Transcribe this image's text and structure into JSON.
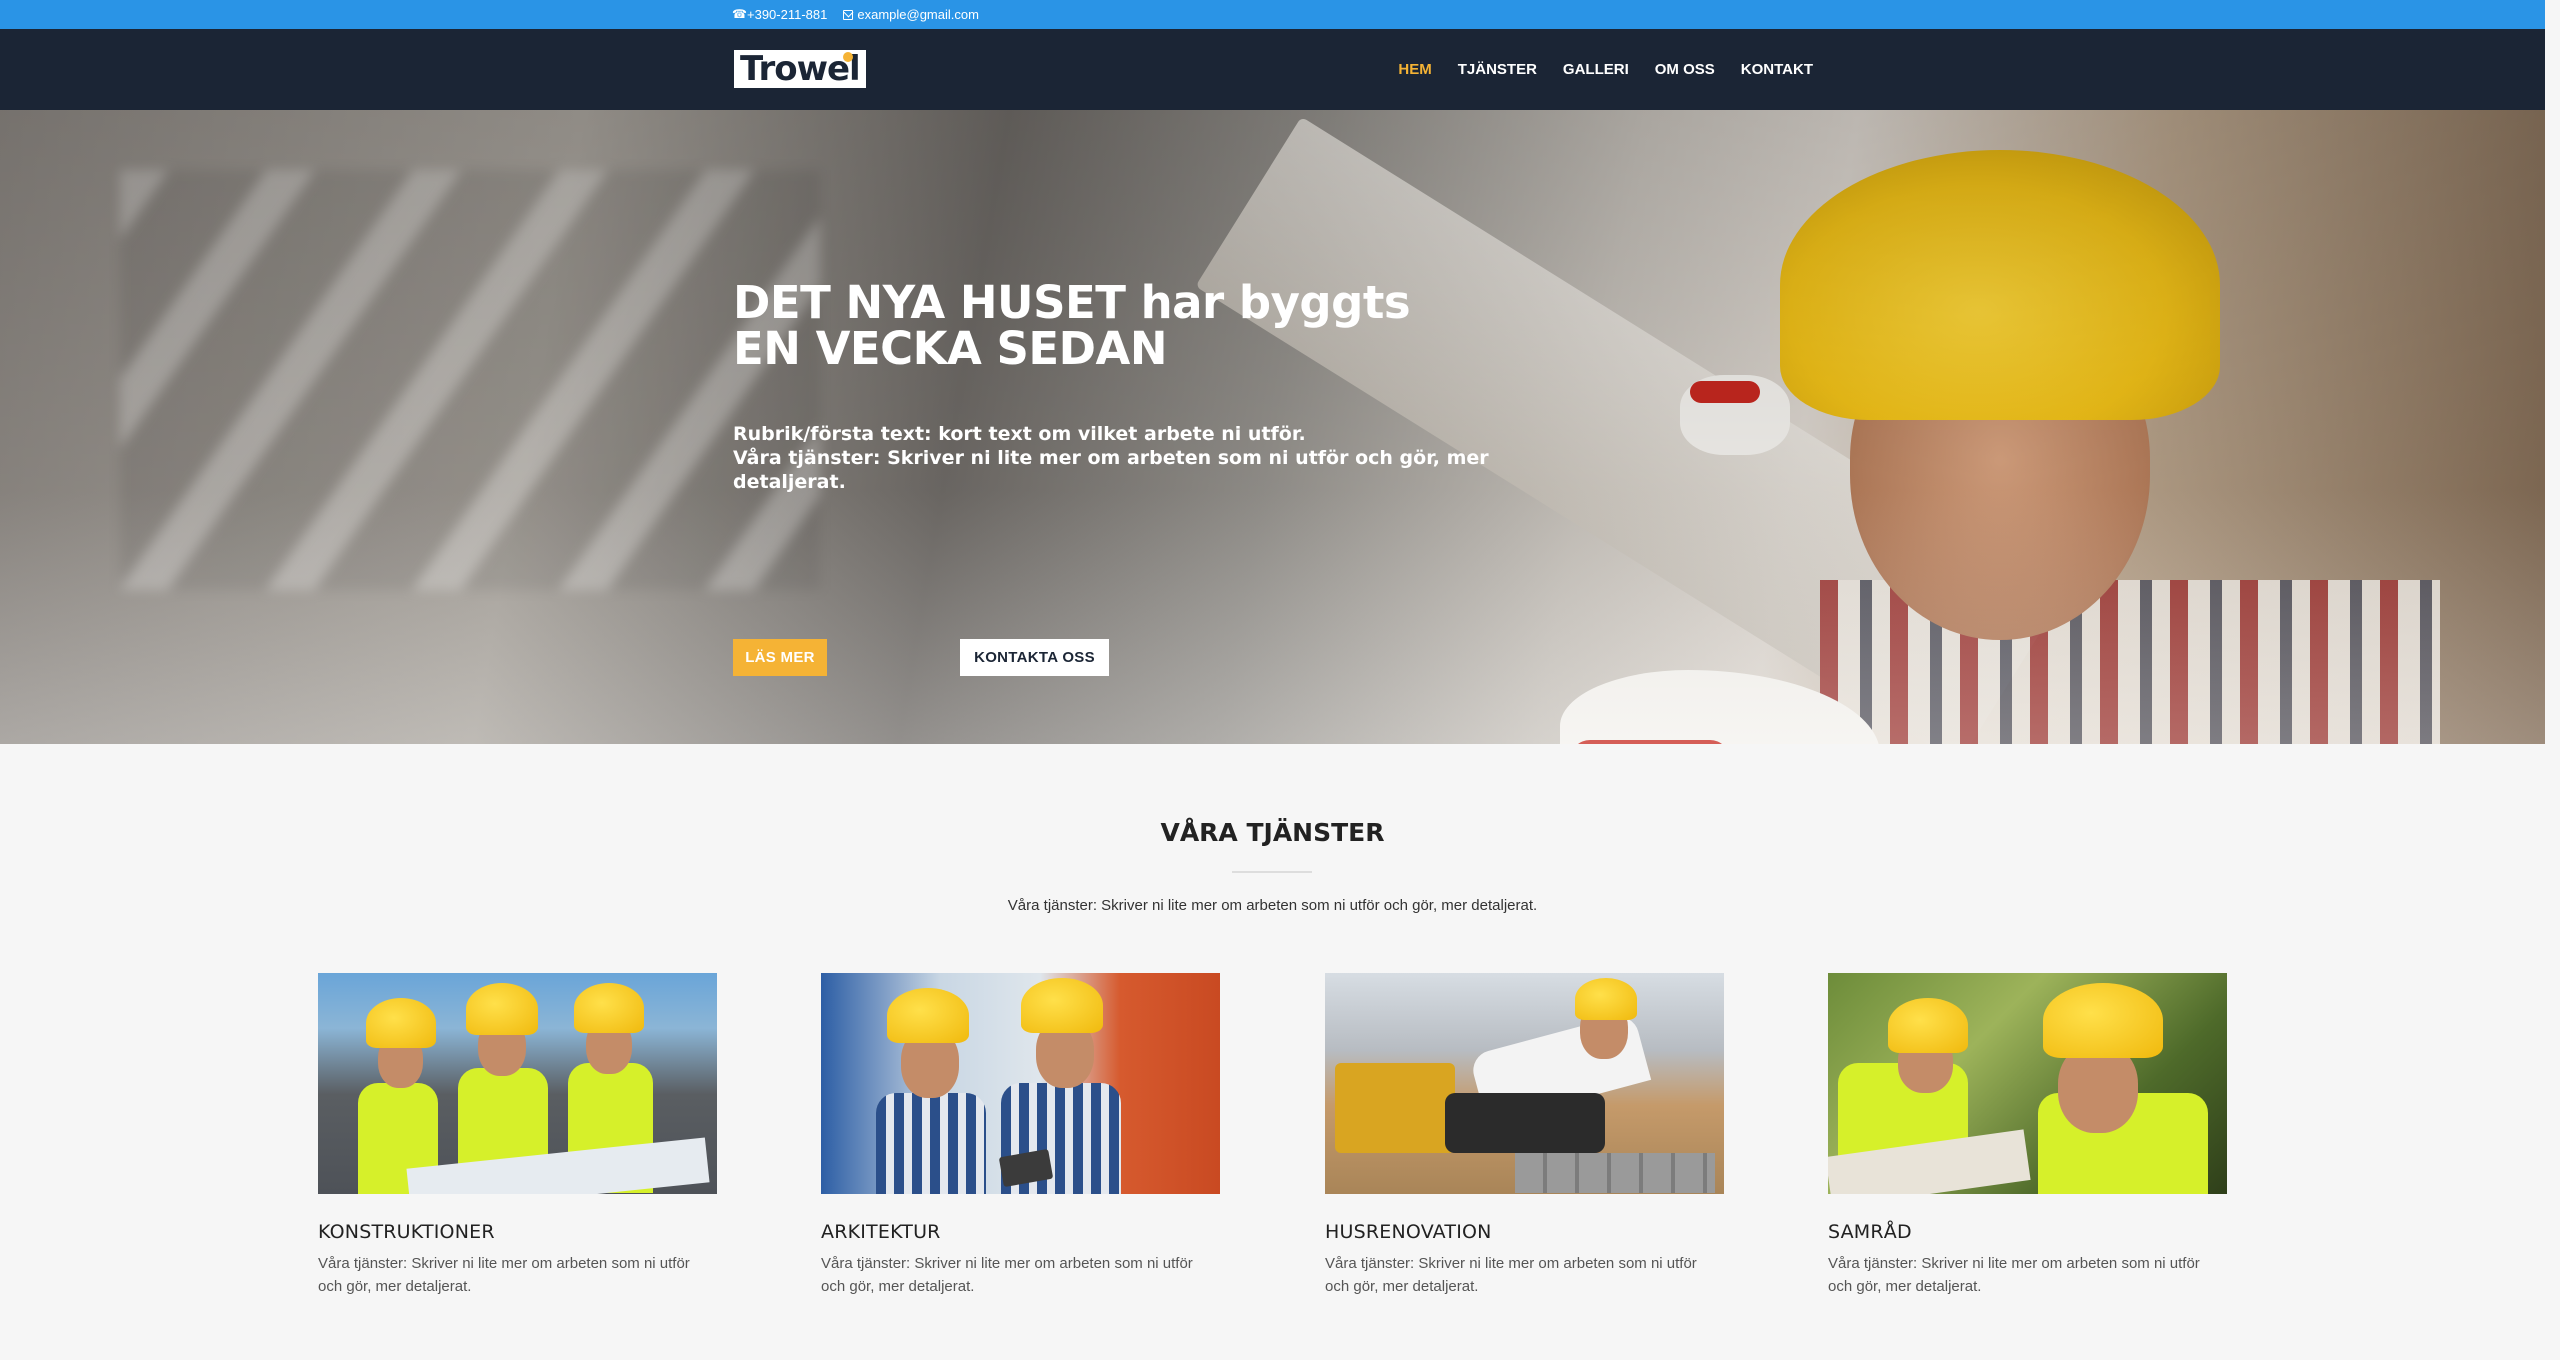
{
  "topbar": {
    "phone": "+390-211-881",
    "email": "example@gmail.com",
    "phone_icon": "phone-icon",
    "email_icon": "envelope-icon"
  },
  "nav": {
    "logo": "Trowel",
    "items": [
      {
        "label": "HEM",
        "active": true
      },
      {
        "label": "TJÄNSTER",
        "active": false
      },
      {
        "label": "GALLERI",
        "active": false
      },
      {
        "label": "OM OSS",
        "active": false
      },
      {
        "label": "KONTAKT",
        "active": false
      }
    ]
  },
  "hero": {
    "title_line1": "DET NYA HUSET har byggts",
    "title_line2": "EN VECKA SEDAN",
    "sub_line1": "Rubrik/första text: kort text om vilket arbete ni utför.",
    "sub_line2": "Våra tjänster: Skriver ni lite mer om arbeten som ni utför och gör, mer detaljerat.",
    "btn_primary": "LÄS MER",
    "btn_secondary": "KONTAKTA OSS"
  },
  "services": {
    "title": "VÅRA TJÄNSTER",
    "description": "Våra tjänster: Skriver ni lite mer om arbeten som ni utför och gör, mer detaljerat.",
    "cards": [
      {
        "name": "KONSTRUKTIONER",
        "text": "Våra tjänster: Skriver ni lite mer om arbeten som ni utför och gör, mer detaljerat."
      },
      {
        "name": "ARKITEKTUR",
        "text": "Våra tjänster: Skriver ni lite mer om arbeten som ni utför och gör, mer detaljerat."
      },
      {
        "name": "HUSRENOVATION",
        "text": "Våra tjänster: Skriver ni lite mer om arbeten som ni utför och gör, mer detaljerat."
      },
      {
        "name": "SAMRÅD",
        "text": "Våra tjänster: Skriver ni lite mer om arbeten som ni utför och gör, mer detaljerat."
      }
    ]
  },
  "colors": {
    "topbar": "#2a94e6",
    "nav": "#1b2535",
    "accent": "#f5b335"
  }
}
